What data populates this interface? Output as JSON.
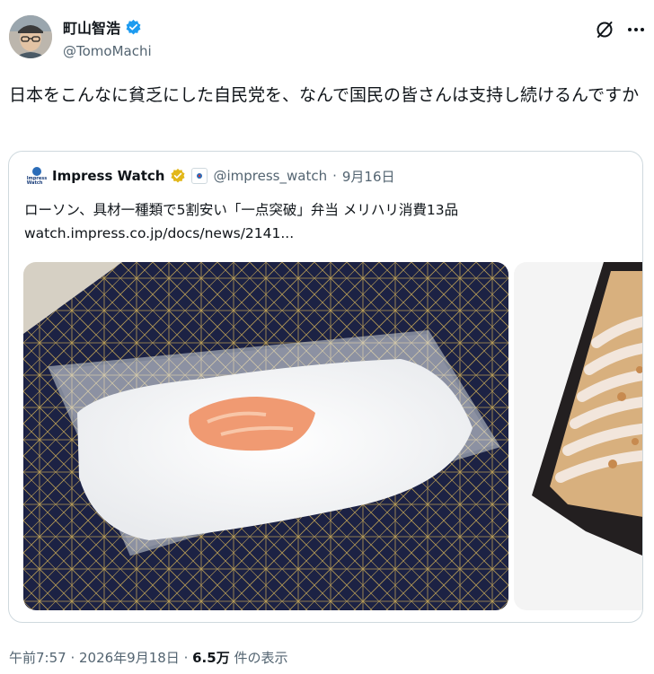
{
  "author": {
    "display_name": "町山智浩",
    "handle": "@TomoMachi",
    "verified": true,
    "verified_color": "#1d9bf0"
  },
  "tweet": {
    "text": "日本をこんなに貧乏にした自民党を、なんで国民の皆さんは支持し続けるんですか"
  },
  "quote": {
    "logo_text": "Impress Watch",
    "name": "Impress Watch",
    "verified_badge_color": "#e2b719",
    "handle": "@impress_watch",
    "separator": " · ",
    "date": "9月16日",
    "headline": "ローソン、具材一種類で5割安い「一点突破」弁当 メリハリ消費13品",
    "link": "watch.impress.co.jp/docs/news/2141..."
  },
  "meta": {
    "time": "午前7:57",
    "sep1": " · ",
    "date": "2026年9月18日",
    "sep2": " · ",
    "views": "6.5万",
    "views_label": " 件の表示"
  },
  "icons": {
    "grok": "grok-icon",
    "more": "more-icon",
    "verified": "verified-badge-icon"
  }
}
